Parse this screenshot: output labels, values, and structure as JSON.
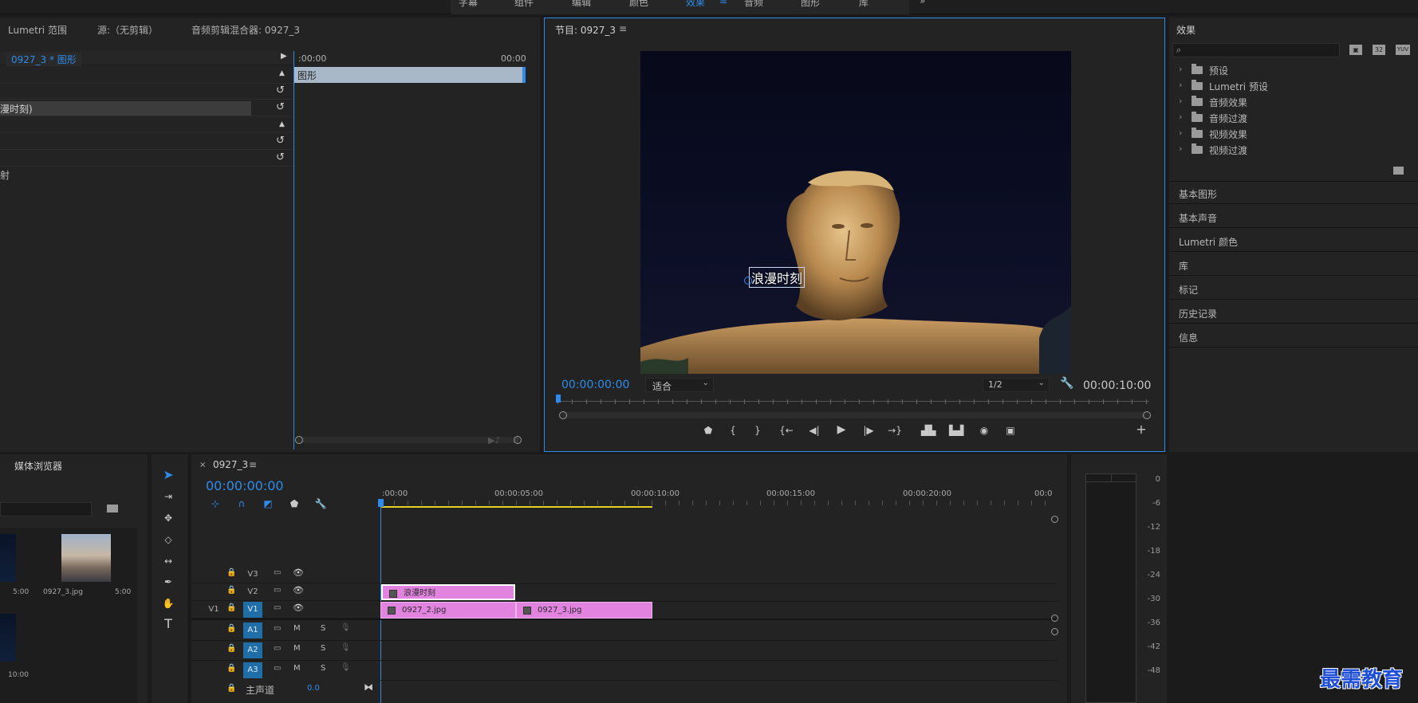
{
  "top_tabs": [
    "字幕",
    "组件",
    "编辑",
    "颜色",
    "效果",
    "音频",
    "图形",
    "库",
    "»"
  ],
  "active_tab_index": 4,
  "source_panel": {
    "tabs": [
      "Lumetri 范围",
      "源:（无剪辑）",
      "音频剪辑混合器: 0927_3"
    ],
    "clip_path": "0927_3 * 图形",
    "time_start": ":00:00",
    "time_end": "00:00",
    "graphic_bar_label": "图形",
    "rows": [
      "",
      "",
      "漫时刻)",
      "",
      "",
      "",
      "射"
    ]
  },
  "program_monitor": {
    "title": "节目: 0927_3",
    "menu_icon": "hamburger-icon",
    "overlay_text": "浪漫时刻",
    "timecode_current": "00:00:00:00",
    "fit_label": "适合",
    "resolution": "1/2",
    "timecode_duration": "00:00:10:00"
  },
  "effects_panel": {
    "title": "效果",
    "search_placeholder": "",
    "filter_buttons": [
      "32",
      "YUV"
    ],
    "folders": [
      "预设",
      "Lumetri 预设",
      "音频效果",
      "音频过渡",
      "视频效果",
      "视频过渡"
    ],
    "side_panels": [
      "基本图形",
      "基本声音",
      "Lumetri 颜色",
      "库",
      "标记",
      "历史记录",
      "信息"
    ]
  },
  "project_panel": {
    "title": "媒体浏览器",
    "items": [
      {
        "name": "",
        "duration": "5:00"
      },
      {
        "name": "0927_3.jpg",
        "duration": "5:00"
      },
      {
        "name": "",
        "duration": "10:00"
      }
    ]
  },
  "timeline": {
    "sequence_name": "0927_3",
    "timecode": "00:00:00:00",
    "ruler": [
      ":00:00",
      "00:00:05:00",
      "00:00:10:00",
      "00:00:15:00",
      "00:00:20:00",
      "00:0"
    ],
    "tracks": [
      "V3",
      "V2",
      "V1",
      "A1",
      "A2",
      "A3"
    ],
    "source_patch_v": "V1",
    "master_label": "主声道",
    "master_value": "0.0",
    "clips": {
      "title_clip": "浪漫时刻",
      "clip1": "0927_2.jpg",
      "clip2": "0927_3.jpg"
    },
    "mute_label": "M",
    "solo_label": "S"
  },
  "audio_meter": {
    "ticks": [
      "0",
      "-6",
      "-12",
      "-18",
      "-24",
      "-30",
      "-36",
      "-42",
      "-48"
    ]
  },
  "watermark": "最需教育",
  "colors": {
    "accent_blue": "#2d8ceb",
    "clip_pink": "#e283e0",
    "track_blue": "#1f6ea7",
    "work_area_yellow": "#e5d024"
  }
}
